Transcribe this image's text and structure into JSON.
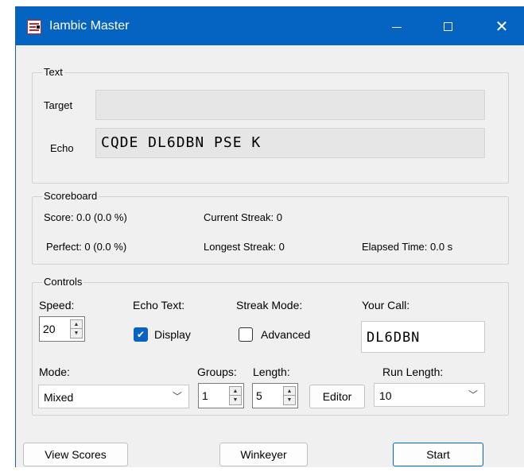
{
  "window": {
    "title": "Iambic Master"
  },
  "text_group": {
    "label": "Text",
    "target_label": "Target",
    "target_value": "",
    "echo_label": "Echo",
    "echo_value": "CQDE DL6DBN PSE K"
  },
  "scoreboard": {
    "label": "Scoreboard",
    "score": "Score: 0.0 (0.0 %)",
    "current_streak": "Current Streak: 0",
    "perfect": "Perfect: 0 (0.0 %)",
    "longest_streak": "Longest Streak: 0",
    "elapsed_time": "Elapsed Time: 0.0 s"
  },
  "controls": {
    "label": "Controls",
    "speed_label": "Speed:",
    "speed_value": "20",
    "echo_text_label": "Echo Text:",
    "display_label": "Display",
    "display_checked": true,
    "streak_mode_label": "Streak Mode:",
    "advanced_label": "Advanced",
    "advanced_checked": false,
    "your_call_label": "Your Call:",
    "your_call_value": "DL6DBN",
    "mode_label": "Mode:",
    "mode_value": "Mixed",
    "groups_label": "Groups:",
    "groups_value": "1",
    "length_label": "Length:",
    "length_value": "5",
    "editor_label": "Editor",
    "run_length_label": "Run Length:",
    "run_length_value": "10"
  },
  "footer": {
    "view_scores_label": "View Scores",
    "winkeyer_label": "Winkeyer",
    "start_label": "Start"
  },
  "icons": {
    "app": "app-icon",
    "minimize": "minimize-icon",
    "maximize": "maximize-icon",
    "close": "close-icon",
    "check": "check-icon",
    "chevron": "chevron-down-icon",
    "spin_up": "spin-up-icon",
    "spin_down": "spin-down-icon"
  },
  "colors": {
    "titlebar": "#0563c1",
    "accent": "#0563c1",
    "window_bg": "#f0f0f0"
  }
}
